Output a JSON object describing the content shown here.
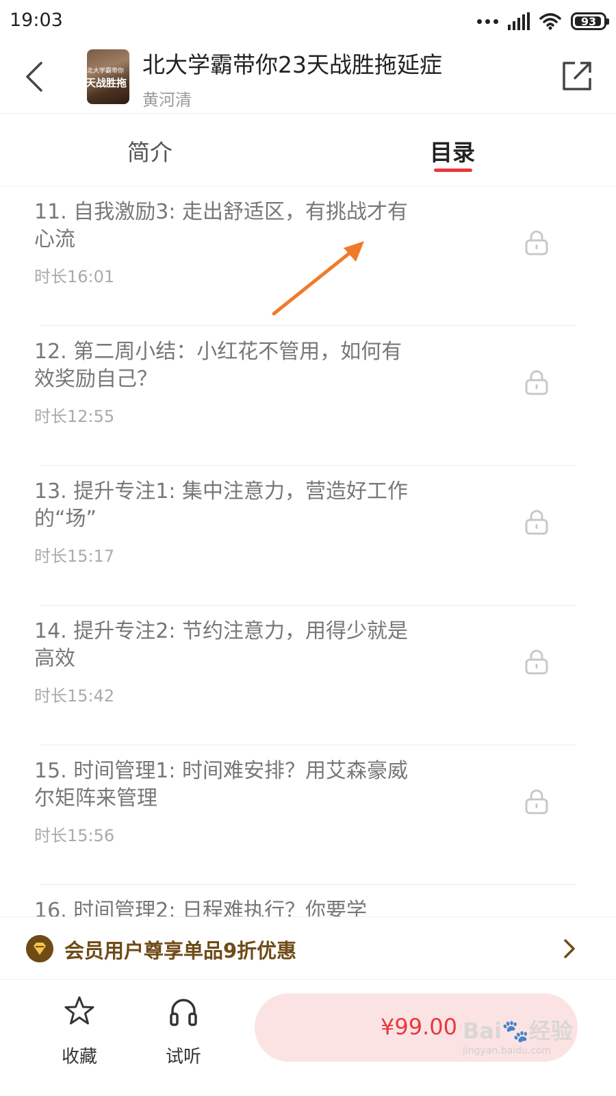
{
  "status_bar": {
    "time": "19:03",
    "battery": "93",
    "icons": [
      "more-dots-icon",
      "signal-icon",
      "wifi-icon",
      "battery-icon"
    ]
  },
  "header": {
    "cover_line1": "北大学霸带你",
    "cover_line2": "天战胜拖",
    "title": "北大学霸带你23天战胜拖延症",
    "author": "黄河清"
  },
  "tabs": [
    {
      "label": "简介",
      "active": false
    },
    {
      "label": "目录",
      "active": true
    }
  ],
  "accent_color": "#e8383d",
  "chapters": [
    {
      "title": "11. 自我激励3: 走出舒适区，有挑战才有心流",
      "duration": "时长16:01",
      "locked": true
    },
    {
      "title": "12. 第二周小结：小红花不管用，如何有效奖励自己？",
      "duration": "时长12:55",
      "locked": true
    },
    {
      "title": "13. 提升专注1: 集中注意力，营造好工作的“场”",
      "duration": "时长15:17",
      "locked": true
    },
    {
      "title": "14. 提升专注2: 节约注意力，用得少就是高效",
      "duration": "时长15:42",
      "locked": true
    },
    {
      "title": "15. 时间管理1: 时间难安排？用艾森豪威尔矩阵来管理",
      "duration": "时长15:56",
      "locked": true
    },
    {
      "title": "16. 时间管理2: 日程难执行？你要学",
      "duration": "",
      "locked": true
    }
  ],
  "promo": {
    "text": "会员用户尊享单品9折优惠",
    "color": "#6e4b17"
  },
  "bottom_bar": {
    "collect_label": "收藏",
    "listen_label": "试听",
    "price": "¥99.00"
  },
  "watermark": {
    "text": "Bai🐾经验",
    "sub": "jingyan.baidu.com"
  }
}
